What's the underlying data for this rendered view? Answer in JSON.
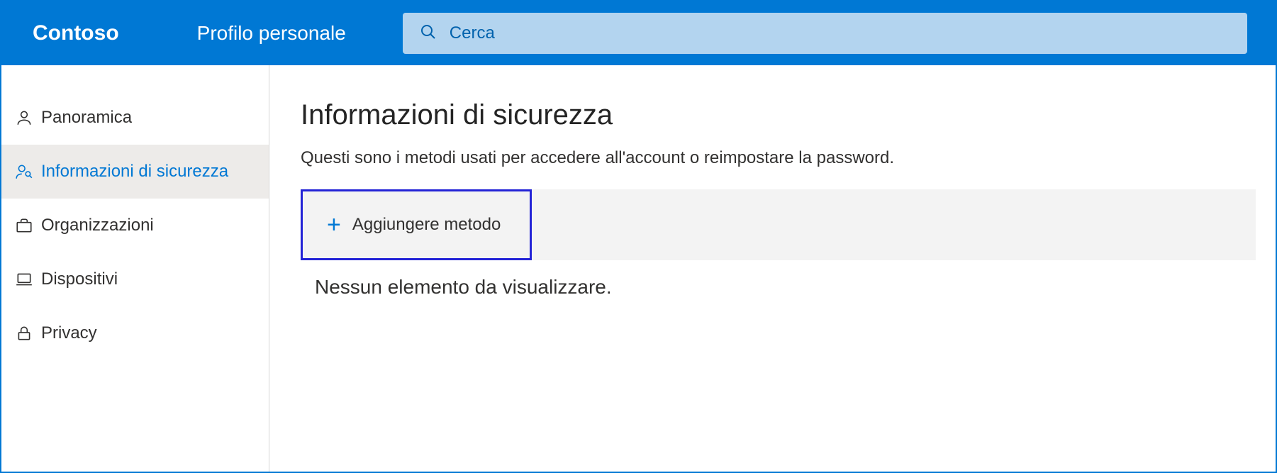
{
  "header": {
    "brand": "Contoso",
    "title": "Profilo personale",
    "search_placeholder": "Cerca"
  },
  "sidebar": {
    "items": [
      {
        "label": "Panoramica"
      },
      {
        "label": "Informazioni di sicurezza"
      },
      {
        "label": "Organizzazioni"
      },
      {
        "label": "Dispositivi"
      },
      {
        "label": "Privacy"
      }
    ]
  },
  "main": {
    "heading": "Informazioni di sicurezza",
    "subtext": "Questi sono i metodi usati per accedere all'account o reimpostare la password.",
    "add_label": "Aggiungere metodo",
    "empty_text": "Nessun elemento da visualizzare."
  }
}
